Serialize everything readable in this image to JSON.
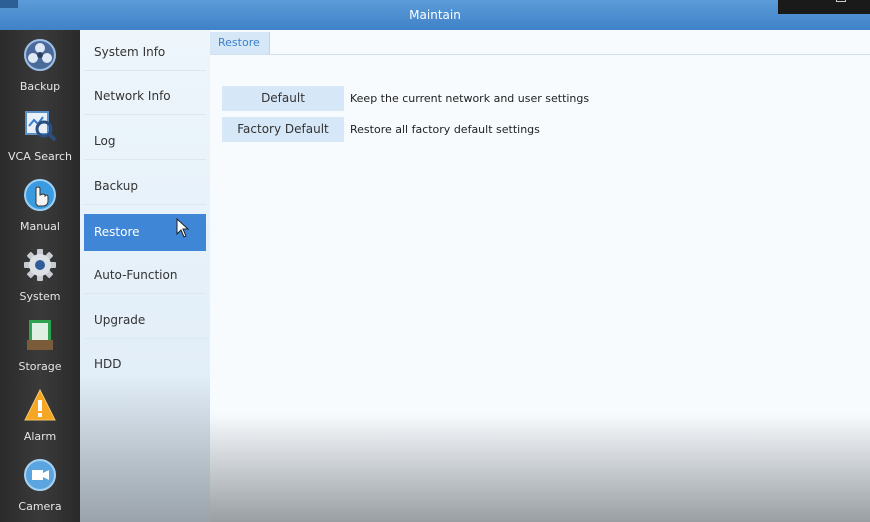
{
  "window": {
    "title": "Maintain"
  },
  "rail": [
    {
      "label": "Backup",
      "icon": "backup-icon"
    },
    {
      "label": "VCA Search",
      "icon": "vca-search-icon"
    },
    {
      "label": "Manual",
      "icon": "manual-hand-icon"
    },
    {
      "label": "System",
      "icon": "gear-icon"
    },
    {
      "label": "Storage",
      "icon": "storage-icon"
    },
    {
      "label": "Alarm",
      "icon": "alarm-warning-icon"
    },
    {
      "label": "Camera",
      "icon": "camera-icon"
    }
  ],
  "menu": {
    "items": [
      "System Info",
      "Network Info",
      "Log",
      "Backup",
      "Restore",
      "Auto-Function",
      "Upgrade",
      "HDD"
    ],
    "active": "Restore"
  },
  "content": {
    "tab": "Restore",
    "options": [
      {
        "button": "Default",
        "description": "Keep the current network and user settings"
      },
      {
        "button": "Factory Default",
        "description": "Restore all factory default settings"
      }
    ]
  },
  "colors": {
    "accent": "#3f86d6",
    "title_bar": "#4a8fd0",
    "button_bg": "#d6e8f7"
  }
}
